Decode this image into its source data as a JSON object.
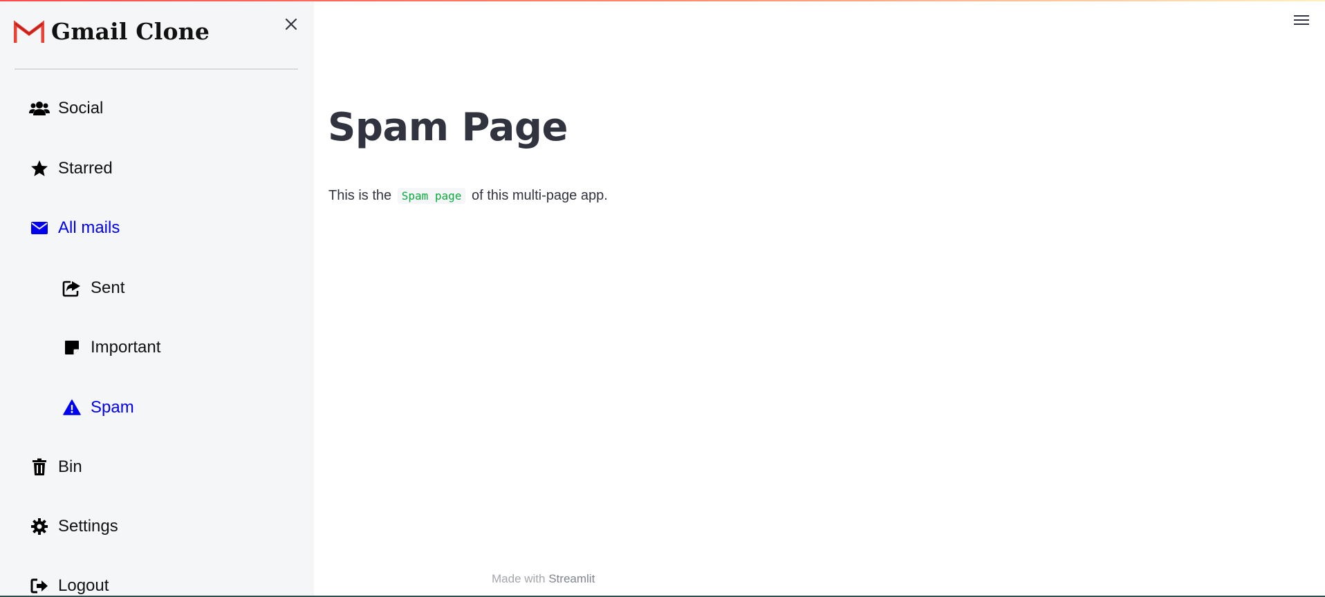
{
  "app": {
    "title": "Gmail Clone",
    "accent_color": "#0000ee",
    "logo_icon": "gmail-m-logo"
  },
  "sidebar": {
    "close_icon": "close-icon",
    "items": [
      {
        "label": "Social",
        "icon": "users-icon",
        "active": false
      },
      {
        "label": "Starred",
        "icon": "star-icon",
        "active": false
      },
      {
        "label": "All mails",
        "icon": "envelope-icon",
        "active": true
      },
      {
        "label": "Sent",
        "icon": "share-square-icon",
        "active": false
      },
      {
        "label": "Important",
        "icon": "sticky-note-icon",
        "active": false
      },
      {
        "label": "Spam",
        "icon": "warning-triangle-icon",
        "active": true
      },
      {
        "label": "Bin",
        "icon": "trash-icon",
        "active": false
      },
      {
        "label": "Settings",
        "icon": "gear-icon",
        "active": false
      },
      {
        "label": "Logout",
        "icon": "sign-out-icon",
        "active": false
      }
    ]
  },
  "main": {
    "menu_icon": "hamburger-menu-icon",
    "heading": "Spam Page",
    "body_prefix": "This is the",
    "body_code": "Spam page",
    "body_suffix": "of this multi-page app."
  },
  "footer": {
    "made_with": "Made with",
    "link_text": "Streamlit"
  }
}
